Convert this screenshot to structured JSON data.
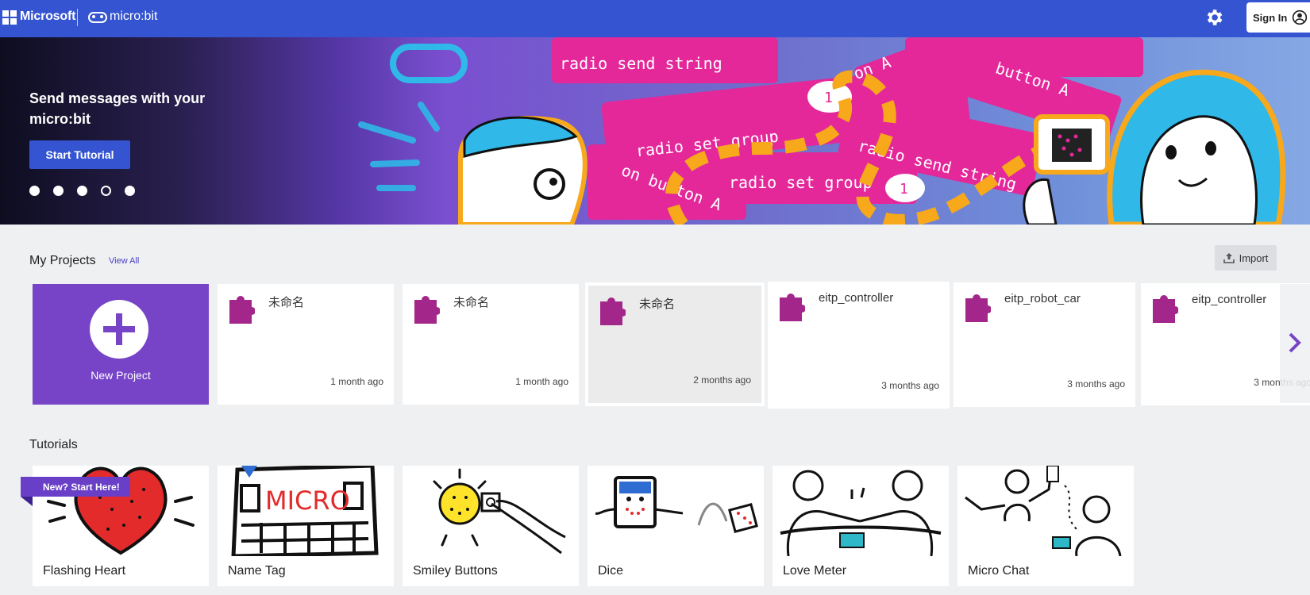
{
  "header": {
    "microsoft_label": "Microsoft",
    "brand_label": "micro:bit",
    "settings_icon": "gear-icon",
    "signin_label": "Sign In",
    "signin_icon": "user-circle-icon",
    "bar_color": "#3454d1"
  },
  "hero": {
    "title": "Send messages with your micro:bit",
    "button_label": "Start Tutorial",
    "carousel_dots": 5,
    "active_dot": 4,
    "block_texts": [
      "radio send string",
      "radio set group",
      "radio send string",
      "radio set group",
      "button A",
      "on A",
      "on button A"
    ],
    "block_numbers": [
      "1",
      "1"
    ]
  },
  "projects": {
    "title": "My Projects",
    "view_all_label": "View All",
    "import_label": "Import",
    "new_project_label": "New Project",
    "items": [
      {
        "name": "未命名",
        "time": "1 month ago"
      },
      {
        "name": "未命名",
        "time": "1 month ago"
      },
      {
        "name": "未命名",
        "time": "2 months ago"
      },
      {
        "name": "eitp_controller",
        "time": "3 months ago"
      },
      {
        "name": "eitp_robot_car",
        "time": "3 months ago"
      },
      {
        "name": "eitp_controller",
        "time": "3 months ago"
      }
    ],
    "accent_color": "#7744c8",
    "puzzle_color": "#a3268a"
  },
  "tutorials": {
    "title": "Tutorials",
    "ribbon_label": "New? Start Here!",
    "items": [
      {
        "name": "Flashing Heart",
        "art_text": ""
      },
      {
        "name": "Name Tag",
        "art_text": "MICRO"
      },
      {
        "name": "Smiley Buttons",
        "art_text": ""
      },
      {
        "name": "Dice",
        "art_text": ""
      },
      {
        "name": "Love Meter",
        "art_text": ""
      },
      {
        "name": "Micro Chat",
        "art_text": ""
      }
    ]
  }
}
